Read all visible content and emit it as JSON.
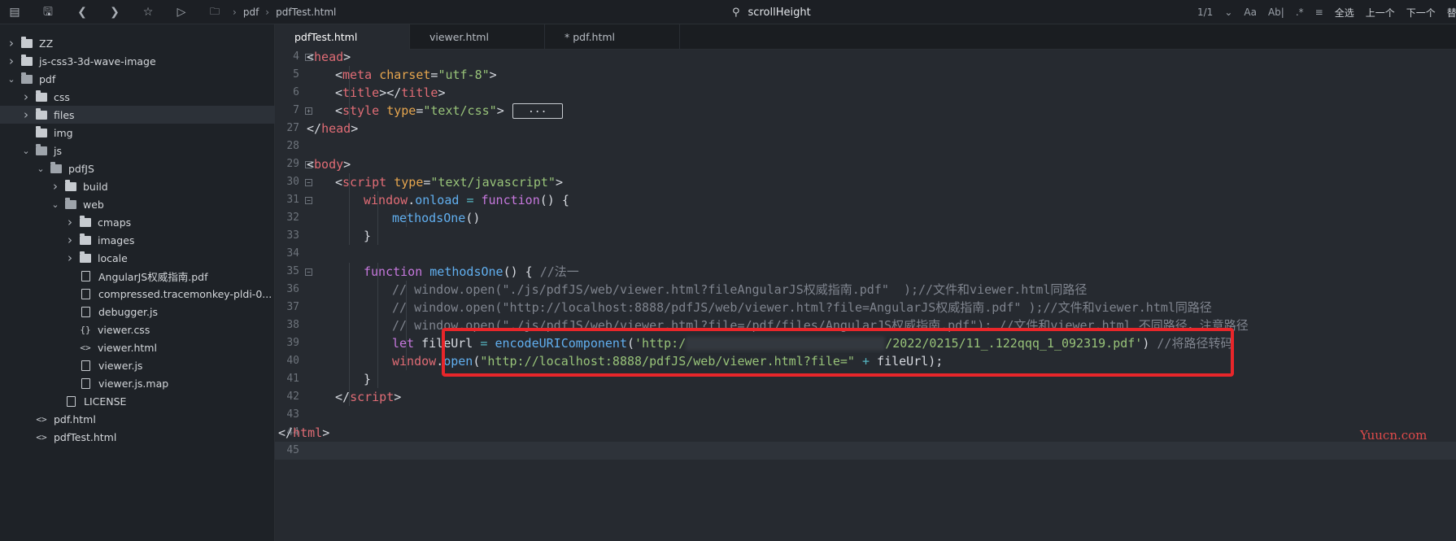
{
  "toolbar": {
    "icons": [
      "bookmark-list-icon",
      "save-icon",
      "back-icon",
      "forward-icon",
      "star-icon",
      "play-icon"
    ],
    "breadcrumb": [
      "pdf",
      "pdfTest.html"
    ],
    "search_value": "scrollHeight",
    "match_count": "1/1",
    "options": [
      "Aa",
      "Ab|",
      ".*"
    ],
    "select_all": "全选",
    "prev": "上一个",
    "next": "下一个",
    "replace": "替换区"
  },
  "sidebar": {
    "items": [
      {
        "label": "ZZ",
        "type": "folder",
        "depth": 0,
        "expanded": false
      },
      {
        "label": "js-css3-3d-wave-image",
        "type": "folder",
        "depth": 0,
        "expanded": false
      },
      {
        "label": "pdf",
        "type": "folder",
        "depth": 0,
        "expanded": true
      },
      {
        "label": "css",
        "type": "folder",
        "depth": 1,
        "expanded": false
      },
      {
        "label": "files",
        "type": "folder",
        "depth": 1,
        "expanded": false,
        "selected": true
      },
      {
        "label": "img",
        "type": "folder",
        "depth": 1,
        "expanded": null
      },
      {
        "label": "js",
        "type": "folder",
        "depth": 1,
        "expanded": true
      },
      {
        "label": "pdfJS",
        "type": "folder",
        "depth": 2,
        "expanded": true
      },
      {
        "label": "build",
        "type": "folder",
        "depth": 3,
        "expanded": false
      },
      {
        "label": "web",
        "type": "folder",
        "depth": 3,
        "expanded": true
      },
      {
        "label": "cmaps",
        "type": "folder",
        "depth": 4,
        "expanded": false
      },
      {
        "label": "images",
        "type": "folder",
        "depth": 4,
        "expanded": false
      },
      {
        "label": "locale",
        "type": "folder",
        "depth": 4,
        "expanded": false
      },
      {
        "label": "AngularJS权威指南.pdf",
        "type": "doc",
        "depth": 4
      },
      {
        "label": "compressed.tracemonkey-pldi-0...",
        "type": "doc",
        "depth": 4
      },
      {
        "label": "debugger.js",
        "type": "js",
        "depth": 4
      },
      {
        "label": "viewer.css",
        "type": "css",
        "depth": 4
      },
      {
        "label": "viewer.html",
        "type": "html",
        "depth": 4
      },
      {
        "label": "viewer.js",
        "type": "doc",
        "depth": 4
      },
      {
        "label": "viewer.js.map",
        "type": "doc",
        "depth": 4
      },
      {
        "label": "LICENSE",
        "type": "doc",
        "depth": 3
      },
      {
        "label": "pdf.html",
        "type": "html",
        "depth": 1
      },
      {
        "label": "pdfTest.html",
        "type": "html",
        "depth": 1
      }
    ]
  },
  "tabs": [
    {
      "label": "pdfTest.html",
      "active": true
    },
    {
      "label": "viewer.html",
      "active": false
    },
    {
      "label": "* pdf.html",
      "active": false
    }
  ],
  "editor": {
    "collapsed_marker": "...",
    "lines": [
      {
        "num": "4",
        "fold": "minus",
        "indent": 1,
        "tokens": [
          [
            "t-br",
            "<"
          ],
          [
            "t-tag",
            "head"
          ],
          [
            "t-br",
            ">"
          ]
        ]
      },
      {
        "num": "5",
        "fold": "",
        "indent": 2,
        "tokens": [
          [
            "t-br",
            "<"
          ],
          [
            "t-tag",
            "meta"
          ],
          [
            "t-pl",
            " "
          ],
          [
            "t-attr",
            "charset"
          ],
          [
            "t-pl",
            "="
          ],
          [
            "t-str",
            "\"utf-8\""
          ],
          [
            "t-br",
            ">"
          ]
        ]
      },
      {
        "num": "6",
        "fold": "",
        "indent": 2,
        "tokens": [
          [
            "t-br",
            "<"
          ],
          [
            "t-tag",
            "title"
          ],
          [
            "t-br",
            "></"
          ],
          [
            "t-tag",
            "title"
          ],
          [
            "t-br",
            ">"
          ]
        ]
      },
      {
        "num": "7",
        "fold": "plus",
        "indent": 2,
        "collapsed": true,
        "tokens": [
          [
            "t-br",
            "<"
          ],
          [
            "t-tag",
            "style"
          ],
          [
            "t-pl",
            " "
          ],
          [
            "t-attr",
            "type"
          ],
          [
            "t-pl",
            "="
          ],
          [
            "t-str",
            "\"text/css\""
          ],
          [
            "t-br",
            ">"
          ]
        ]
      },
      {
        "num": "27",
        "fold": "",
        "indent": 1,
        "tokens": [
          [
            "t-br",
            "</"
          ],
          [
            "t-tag",
            "head"
          ],
          [
            "t-br",
            ">"
          ]
        ]
      },
      {
        "num": "28",
        "fold": "",
        "indent": 0,
        "tokens": []
      },
      {
        "num": "29",
        "fold": "minus",
        "indent": 1,
        "tokens": [
          [
            "t-br",
            "<"
          ],
          [
            "t-tag",
            "body"
          ],
          [
            "t-br",
            ">"
          ]
        ]
      },
      {
        "num": "30",
        "fold": "minus",
        "indent": 2,
        "tokens": [
          [
            "t-br",
            "<"
          ],
          [
            "t-tag",
            "script"
          ],
          [
            "t-pl",
            " "
          ],
          [
            "t-attr",
            "type"
          ],
          [
            "t-pl",
            "="
          ],
          [
            "t-str",
            "\"text/javascript\""
          ],
          [
            "t-br",
            ">"
          ]
        ]
      },
      {
        "num": "31",
        "fold": "minus",
        "indent": 3,
        "tokens": [
          [
            "t-tag",
            "window"
          ],
          [
            "t-pl",
            "."
          ],
          [
            "t-fn",
            "onload"
          ],
          [
            "t-pl",
            " "
          ],
          [
            "t-op",
            "="
          ],
          [
            "t-pl",
            " "
          ],
          [
            "t-kw",
            "function"
          ],
          [
            "t-pl",
            "() {"
          ]
        ]
      },
      {
        "num": "32",
        "fold": "",
        "indent": 4,
        "tokens": [
          [
            "t-fn",
            "methodsOne"
          ],
          [
            "t-pl",
            "()"
          ]
        ]
      },
      {
        "num": "33",
        "fold": "",
        "indent": 3,
        "tokens": [
          [
            "t-pl",
            "}"
          ]
        ]
      },
      {
        "num": "34",
        "fold": "",
        "indent": 0,
        "tokens": []
      },
      {
        "num": "35",
        "fold": "minus",
        "indent": 3,
        "tokens": [
          [
            "t-kw",
            "function"
          ],
          [
            "t-pl",
            " "
          ],
          [
            "t-fn",
            "methodsOne"
          ],
          [
            "t-pl",
            "() { "
          ],
          [
            "t-cm",
            "//法一"
          ]
        ]
      },
      {
        "num": "36",
        "fold": "",
        "indent": 4,
        "tokens": [
          [
            "t-cm",
            "// window.open(\"./js/pdfJS/web/viewer.html?fileAngularJS权威指南.pdf\"  );//文件和viewer.html同路径"
          ]
        ]
      },
      {
        "num": "37",
        "fold": "",
        "indent": 4,
        "tokens": [
          [
            "t-cm",
            "// window.open(\"http://localhost:8888/pdfJS/web/viewer.html?file=AngularJS权威指南.pdf\" );//文件和viewer.html同路径"
          ]
        ]
      },
      {
        "num": "38",
        "fold": "",
        "indent": 4,
        "tokens": [
          [
            "t-cm",
            "// window.open(\"./js/pdfJS/web/viewer.html?file=/pdf/files/AngularJS权威指南.pdf\"); //文件和viewer.html 不同路径，注意路径"
          ]
        ]
      },
      {
        "num": "39",
        "fold": "",
        "indent": 4,
        "blurred": true,
        "tokens": [
          [
            "t-kw",
            "let"
          ],
          [
            "t-pl",
            " fileUrl "
          ],
          [
            "t-op",
            "="
          ],
          [
            "t-pl",
            " "
          ],
          [
            "t-fn",
            "encodeURIComponent"
          ],
          [
            "t-pl",
            "("
          ],
          [
            "t-str",
            "'http:/"
          ],
          [
            "blur",
            ""
          ],
          [
            "t-str",
            "/2022/0215/11_.122qqq_1_092319.pdf'"
          ],
          [
            "t-pl",
            ") "
          ],
          [
            "t-cm",
            "//将路径转码"
          ]
        ]
      },
      {
        "num": "40",
        "fold": "",
        "indent": 4,
        "tokens": [
          [
            "t-tag",
            "window"
          ],
          [
            "t-pl",
            "."
          ],
          [
            "t-fn",
            "open"
          ],
          [
            "t-pl",
            "("
          ],
          [
            "t-str",
            "\"http://localhost:8888/pdfJS/web/viewer.html?file=\""
          ],
          [
            "t-pl",
            " "
          ],
          [
            "t-op",
            "+"
          ],
          [
            "t-pl",
            " fileUrl);"
          ]
        ]
      },
      {
        "num": "41",
        "fold": "",
        "indent": 3,
        "tokens": [
          [
            "t-pl",
            "}"
          ]
        ]
      },
      {
        "num": "42",
        "fold": "",
        "indent": 2,
        "tokens": [
          [
            "t-br",
            "</"
          ],
          [
            "t-tag",
            "script"
          ],
          [
            "t-br",
            ">"
          ]
        ]
      },
      {
        "num": "43",
        "fold": "",
        "indent": 0,
        "tokens": []
      },
      {
        "num": "44",
        "fold": "",
        "indent": 0,
        "tokens": [
          [
            "t-br",
            "</"
          ],
          [
            "t-tag",
            "html"
          ],
          [
            "t-br",
            ">"
          ]
        ]
      },
      {
        "num": "45",
        "fold": "",
        "indent": 0,
        "current": true,
        "tokens": []
      }
    ]
  },
  "annotation": {
    "color": "#e8262a"
  },
  "watermark": "Yuucn.com"
}
